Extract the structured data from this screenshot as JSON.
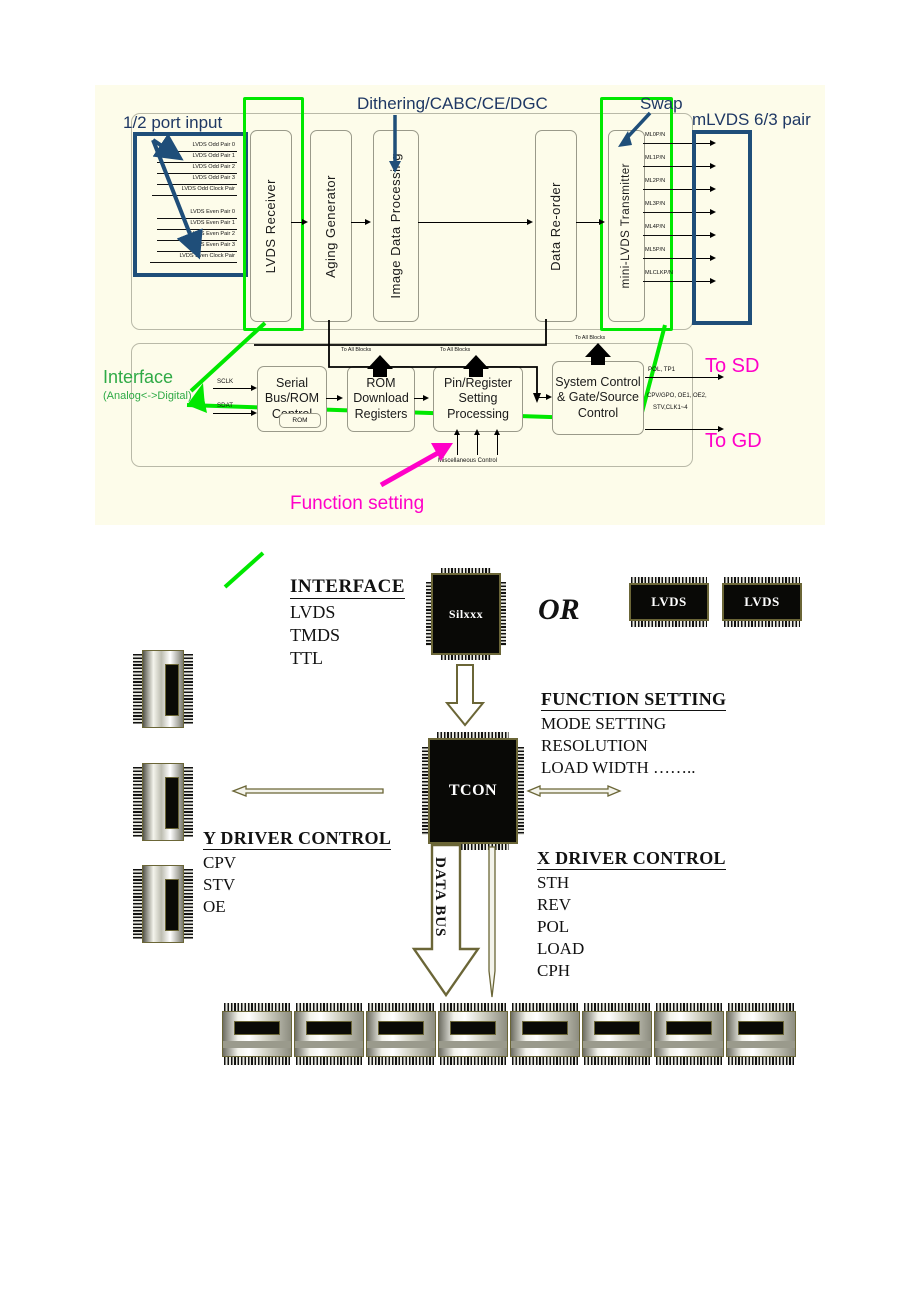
{
  "top_diagram": {
    "callouts": {
      "port_input": "1/2 port input",
      "dithering": "Dithering/CABC/CE/DGC",
      "swap": "Swap",
      "mlvds_pair": "mLVDS 6/3 pair",
      "interface": "Interface",
      "interface_sub": "(Analog<->Digital)",
      "function_setting": "Function setting",
      "to_sd": "To SD",
      "to_gd": "To GD"
    },
    "input_pins": [
      "LVDS Odd Pair 0",
      "LVDS Odd Pair 1",
      "LVDS Odd Pair 2",
      "LVDS Odd Pair 3",
      "LVDS Odd Clock Pair",
      "LVDS Even Pair 0",
      "LVDS Even Pair 1",
      "LVDS Even Pair 2",
      "LVDS Even Pair 3",
      "LVDS Even Clock Pair"
    ],
    "output_pins": [
      "ML0P/N",
      "ML1P/N",
      "ML2P/N",
      "ML3P/N",
      "ML4P/N",
      "ML5P/N",
      "MLCLKP/N"
    ],
    "pipeline_blocks": [
      "LVDS Receiver",
      "Aging Generator",
      "Image Data Processing",
      "Data Re-order",
      "mini-LVDS Transmitter"
    ],
    "control_blocks": [
      "Serial Bus/ROM Control",
      "ROM Download Registers",
      "Pin/Register Setting Processing",
      "System Control & Gate/Source Control"
    ],
    "rom_tag": "ROM",
    "serial_inputs": [
      "SCLK",
      "SDAT"
    ],
    "to_all_blocks": "To All Blocks",
    "misc_control": "Miscellaneous Control",
    "sd_signals": "POL, TP1",
    "gd_signals_line1": "CPV/GPO, OE1, OE2,",
    "gd_signals_line2": "STV,CLK1~4"
  },
  "bottom_diagram": {
    "interface": {
      "title": "INTERFACE",
      "items": [
        "LVDS",
        "TMDS",
        "TTL"
      ]
    },
    "or_label": "OR",
    "chips": {
      "interface_chip": "Silxxx",
      "lvds_chip_1": "LVDS",
      "lvds_chip_2": "LVDS",
      "tcon": "TCON"
    },
    "function_setting": {
      "title": "FUNCTION SETTING",
      "items": [
        "MODE SETTING",
        "RESOLUTION",
        "LOAD WIDTH …….."
      ]
    },
    "y_driver": {
      "title": "Y DRIVER CONTROL",
      "items": [
        "CPV",
        "STV",
        "OE"
      ]
    },
    "x_driver": {
      "title": "X DRIVER CONTROL",
      "items": [
        "STH",
        "REV",
        "POL",
        "LOAD",
        "CPH"
      ]
    },
    "data_bus_label": "DATA BUS",
    "source_driver_count": 8,
    "gate_driver_count": 3
  },
  "colors": {
    "navy": "#1f4e79",
    "green": "#00e800",
    "magenta": "#ff00c8",
    "cream_bg": "#fdfcea",
    "chip_gold": "#6b6637"
  }
}
